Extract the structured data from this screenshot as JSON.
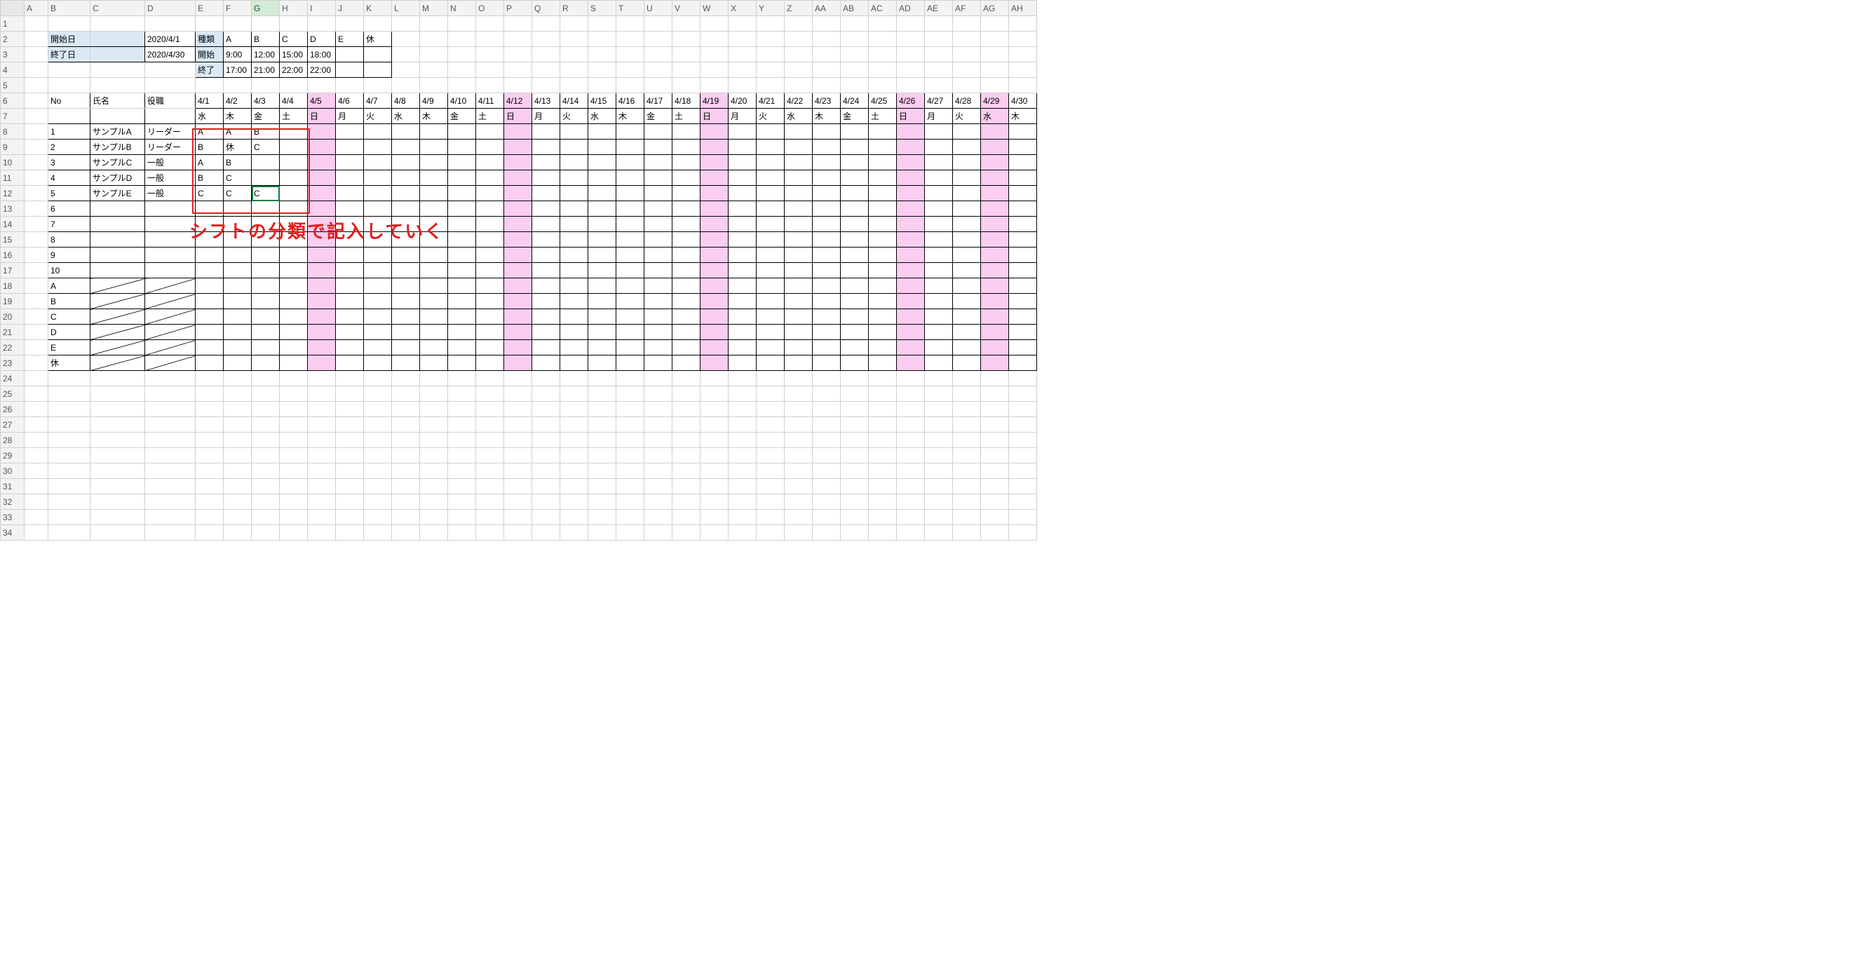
{
  "colHeaders": [
    "",
    "A",
    "B",
    "C",
    "D",
    "E",
    "F",
    "G",
    "H",
    "I",
    "J",
    "K",
    "L",
    "M",
    "N",
    "O",
    "P",
    "Q",
    "R",
    "S",
    "T",
    "U",
    "V",
    "W",
    "X",
    "Y",
    "Z",
    "AA",
    "AB",
    "AC",
    "AD",
    "AE",
    "AF",
    "AG",
    "AH"
  ],
  "rowCount": 34,
  "selectedColumn": "G",
  "selectedCell": {
    "col": "G",
    "row": 12
  },
  "dateBlock": {
    "startLabel": "開始日",
    "startValue": "2020/4/1",
    "endLabel": "終了日",
    "endValue": "2020/4/30"
  },
  "typeBlock": {
    "typeLabel": "種類",
    "types": [
      "A",
      "B",
      "C",
      "D",
      "E",
      "休"
    ],
    "startLabel": "開始",
    "startTimes": [
      "9:00",
      "12:00",
      "15:00",
      "18:00",
      "",
      ""
    ],
    "endLabel": "終了",
    "endTimes": [
      "17:00",
      "21:00",
      "22:00",
      "22:00",
      "",
      ""
    ]
  },
  "scheduleHeader": {
    "no": "No",
    "name": "氏名",
    "role": "役職",
    "dates": [
      "4/1",
      "4/2",
      "4/3",
      "4/4",
      "4/5",
      "4/6",
      "4/7",
      "4/8",
      "4/9",
      "4/10",
      "4/11",
      "4/12",
      "4/13",
      "4/14",
      "4/15",
      "4/16",
      "4/17",
      "4/18",
      "4/19",
      "4/20",
      "4/21",
      "4/22",
      "4/23",
      "4/24",
      "4/25",
      "4/26",
      "4/27",
      "4/28",
      "4/29",
      "4/30"
    ],
    "dows": [
      "水",
      "木",
      "金",
      "土",
      "日",
      "月",
      "火",
      "水",
      "木",
      "金",
      "土",
      "日",
      "月",
      "火",
      "水",
      "木",
      "金",
      "土",
      "日",
      "月",
      "火",
      "水",
      "木",
      "金",
      "土",
      "日",
      "月",
      "火",
      "水",
      "木"
    ],
    "pinkDates": [
      5,
      12,
      19,
      26,
      29
    ]
  },
  "staff": [
    {
      "no": 1,
      "name": "サンプルA",
      "role": "リーダー",
      "shifts": [
        "A",
        "A",
        "B"
      ]
    },
    {
      "no": 2,
      "name": "サンプルB",
      "role": "リーダー",
      "shifts": [
        "B",
        "休",
        "C"
      ]
    },
    {
      "no": 3,
      "name": "サンプルC",
      "role": "一般",
      "shifts": [
        "A",
        "B",
        ""
      ]
    },
    {
      "no": 4,
      "name": "サンプルD",
      "role": "一般",
      "shifts": [
        "B",
        "C",
        ""
      ]
    },
    {
      "no": 5,
      "name": "サンプルE",
      "role": "一般",
      "shifts": [
        "C",
        "C",
        "C"
      ]
    },
    {
      "no": 6,
      "name": "",
      "role": "",
      "shifts": []
    },
    {
      "no": 7,
      "name": "",
      "role": "",
      "shifts": []
    },
    {
      "no": 8,
      "name": "",
      "role": "",
      "shifts": []
    },
    {
      "no": 9,
      "name": "",
      "role": "",
      "shifts": []
    },
    {
      "no": 10,
      "name": "",
      "role": "",
      "shifts": []
    }
  ],
  "summaryRows": [
    "A",
    "B",
    "C",
    "D",
    "E",
    "休"
  ],
  "annotation": {
    "text": "シフトの分類で記入していく"
  }
}
